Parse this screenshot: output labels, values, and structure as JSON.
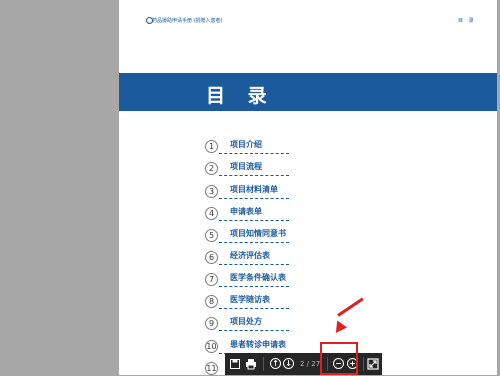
{
  "header": {
    "title": "药品援助申请手册 (捐赠入患者)",
    "right_label": "目 录"
  },
  "banner": {
    "title": "目 录"
  },
  "toc": [
    {
      "num": "1",
      "label": "项目介绍"
    },
    {
      "num": "2",
      "label": "项目流程"
    },
    {
      "num": "3",
      "label": "项目材料清单"
    },
    {
      "num": "4",
      "label": "申请表单"
    },
    {
      "num": "5",
      "label": "项目知情同意书"
    },
    {
      "num": "6",
      "label": "经济评估表"
    },
    {
      "num": "7",
      "label": "医学条件确认表"
    },
    {
      "num": "8",
      "label": "医学随访表"
    },
    {
      "num": "9",
      "label": "项目处方"
    },
    {
      "num": "10",
      "label": "患者转诊申请表"
    },
    {
      "num": "11",
      "label": ""
    }
  ],
  "toolbar": {
    "page_indicator": "2 / 27",
    "zoom_out": "−",
    "zoom_in": "+"
  },
  "colors": {
    "brand_blue": "#1c5b9b",
    "annotation_red": "#e02020",
    "toolbar_bg": "#262626",
    "viewer_bg": "#a7a7a7"
  }
}
